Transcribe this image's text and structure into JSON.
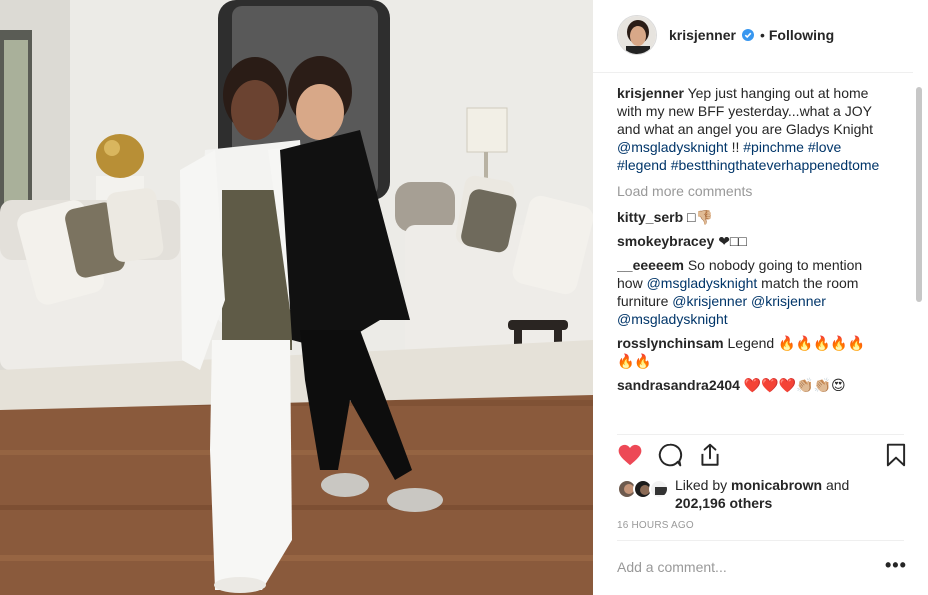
{
  "post": {
    "photo_icon": "photo-of-two-women-in-living-room",
    "author": {
      "username": "krisjenner",
      "verified": true,
      "separator": "•",
      "follow_status": "Following"
    },
    "caption": {
      "username": "krisjenner",
      "text_1": "Yep just hanging out at home with my new BFF yesterday...what a JOY and what an angel you are Gladys Knight",
      "mention": "@msgladysknight",
      "text_2": "!!",
      "tags": [
        "#pinchme",
        "#love",
        "#legend",
        "#bestthingthateverhappenedtome"
      ]
    },
    "load_more": "Load more comments",
    "comments": [
      {
        "username": "kitty_serb",
        "text": "□👎🏼"
      },
      {
        "username": "smokeybracey",
        "text": "❤□□"
      },
      {
        "username": "__eeeeem",
        "text_1": "So nobody going to mention how",
        "mention_1": "@msgladysknight",
        "text_2": "match the room furniture",
        "mention_2": "@krisjenner",
        "mention_3": "@krisjenner",
        "mention_4": "@msgladysknight"
      },
      {
        "username": "rosslynchinsam",
        "text": "Legend 🔥🔥🔥🔥🔥🔥🔥"
      },
      {
        "username": "sandrasandra2404",
        "text": "❤️❤️❤️👏🏼👏🏼😍"
      }
    ],
    "likes": {
      "prefix": "Liked by",
      "user": "monicabrown",
      "middle": "and",
      "count": "202,196 others"
    },
    "timestamp": "16 HOURS AGO",
    "add_comment_placeholder": "Add a comment...",
    "more_options": "•••",
    "colors": {
      "liked_heart": "#ed4956",
      "link": "#003569",
      "muted": "#999999",
      "verified": "#3897f0"
    }
  }
}
